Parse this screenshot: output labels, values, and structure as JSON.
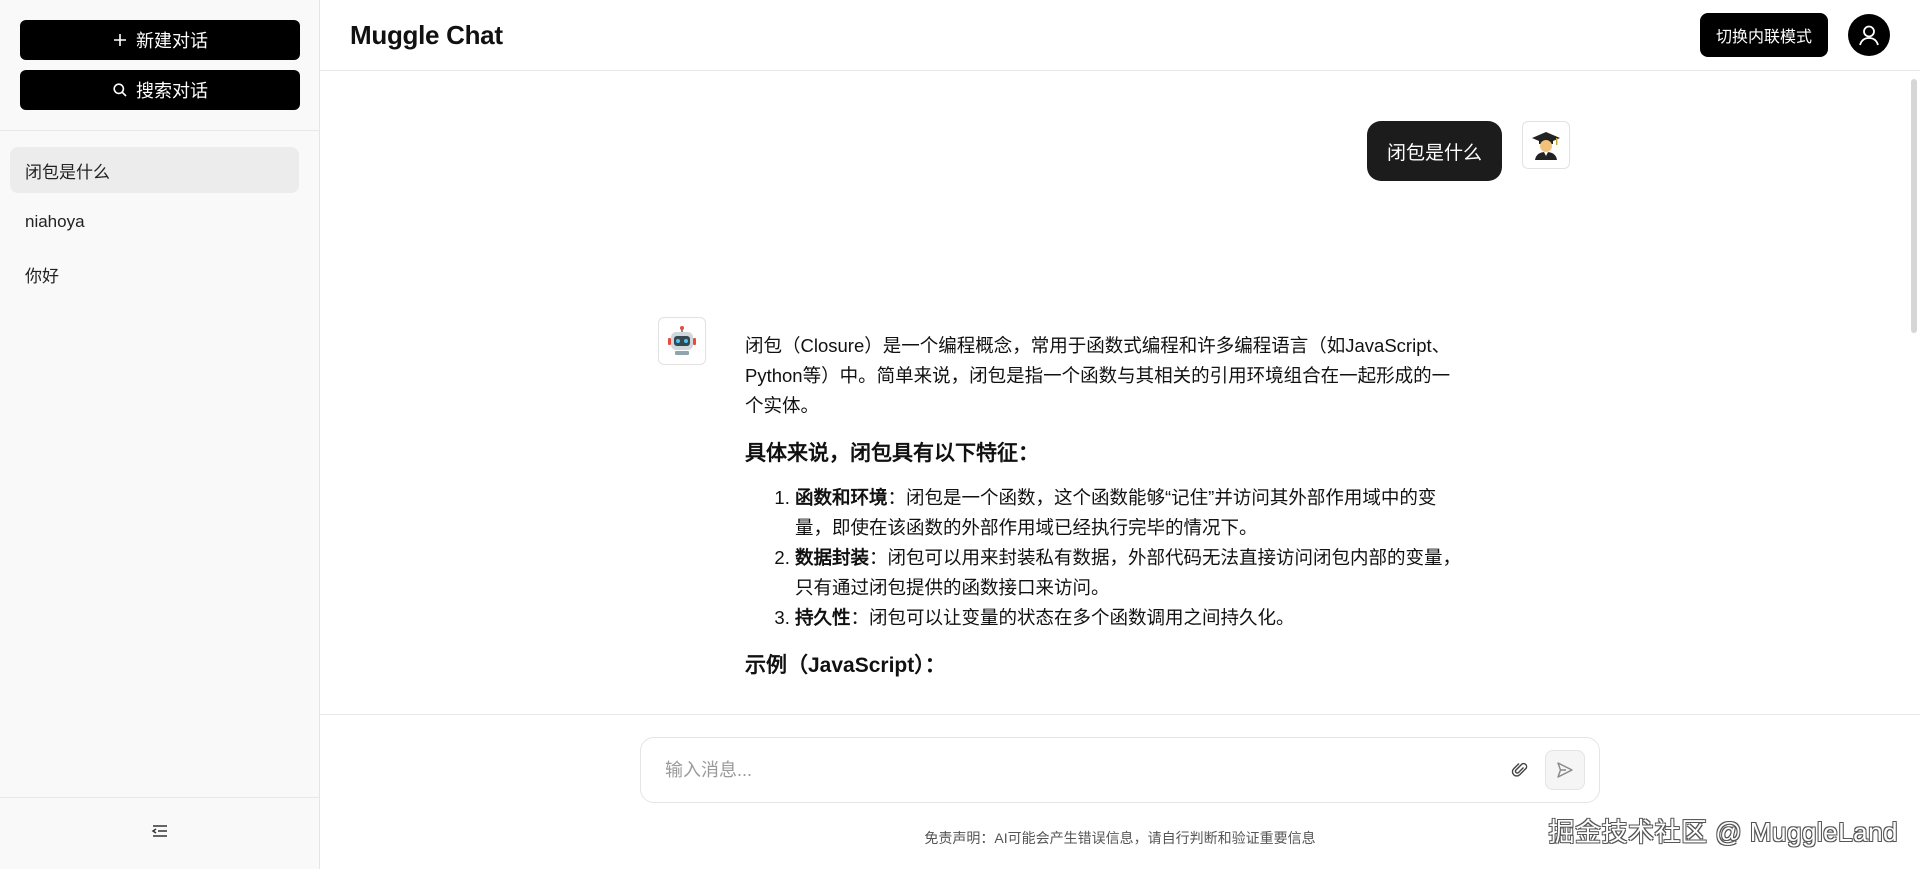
{
  "sidebar": {
    "new_chat_label": "新建对话",
    "search_chat_label": "搜索对话",
    "conversations": [
      {
        "label": "闭包是什么",
        "active": true
      },
      {
        "label": "niahoya",
        "active": false
      },
      {
        "label": "你好",
        "active": false
      }
    ],
    "collapse_icon": "sidebar-collapse-icon"
  },
  "header": {
    "title": "Muggle Chat",
    "mode_button_label": "切换内联模式",
    "avatar_icon": "user-avatar-icon"
  },
  "chat": {
    "user_message": "闭包是什么",
    "bot_intro": "闭包（Closure）是一个编程概念，常用于函数式编程和许多编程语言（如JavaScript、Python等）中。简单来说，闭包是指一个函数与其相关的引用环境组合在一起形成的一个实体。",
    "heading_features": "具体来说，闭包具有以下特征：",
    "features": [
      {
        "title": "函数和环境",
        "text": "：闭包是一个函数，这个函数能够“记住”并访问其外部作用域中的变量，即使在该函数的外部作用域已经执行完毕的情况下。"
      },
      {
        "title": "数据封装",
        "text": "：闭包可以用来封装私有数据，外部代码无法直接访问闭包内部的变量，只有通过闭包提供的函数接口来访问。"
      },
      {
        "title": "持久性",
        "text": "：闭包可以让变量的状态在多个函数调用之间持久化。"
      }
    ],
    "heading_example": "示例（JavaScript）："
  },
  "composer": {
    "placeholder": "输入消息...",
    "value": ""
  },
  "footer": {
    "disclaimer": "免责声明：AI可能会产生错误信息，请自行判断和验证重要信息",
    "watermark": "掘金技术社区 @ MuggleLand"
  }
}
